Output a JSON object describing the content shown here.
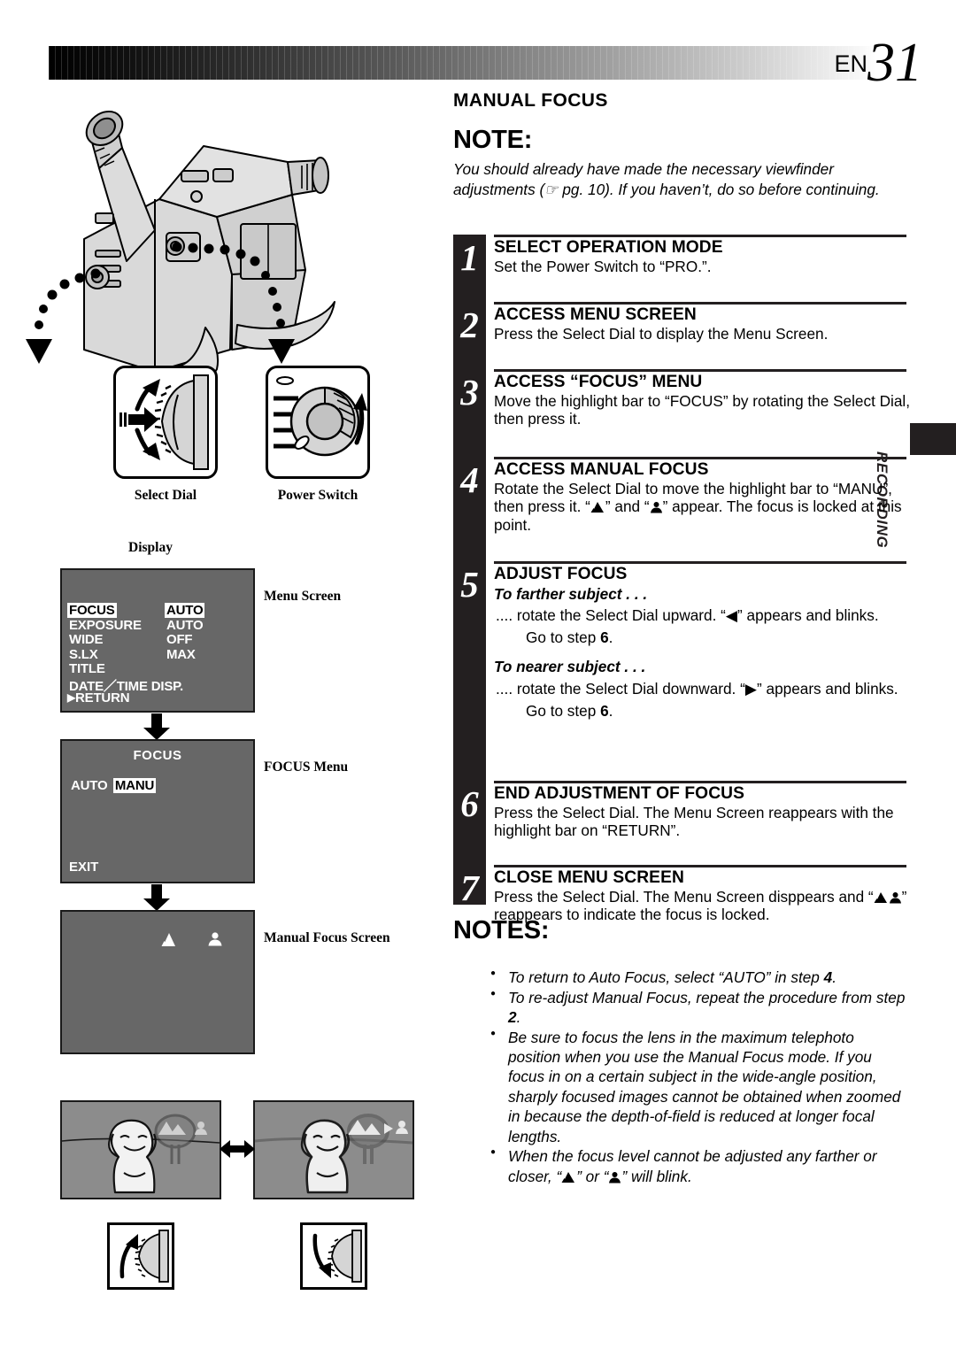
{
  "header": {
    "page_prefix": "EN",
    "page_number": "31"
  },
  "side_tab": {
    "label": "RECORDING"
  },
  "section": {
    "title": "MANUAL FOCUS",
    "note_heading": "NOTE:",
    "note_body": "You should already have made the necessary viewfinder adjustments (☞ pg. 10). If you haven’t, do so before continuing."
  },
  "steps": [
    {
      "num": "1",
      "title": "SELECT OPERATION MODE",
      "body": "Set the Power Switch to “PRO.”."
    },
    {
      "num": "2",
      "title": "ACCESS MENU SCREEN",
      "body": "Press the Select Dial to display the Menu Screen."
    },
    {
      "num": "3",
      "title": "ACCESS “FOCUS” MENU",
      "body": "Move the highlight bar to “FOCUS” by rotating the Select Dial, then press it."
    },
    {
      "num": "4",
      "title": "ACCESS MANUAL FOCUS",
      "body_a": "Rotate the Select Dial to move the highlight bar to “MANU”, then press it. “",
      "body_b": "” and “",
      "body_c": "” appear. The focus is locked at this point."
    },
    {
      "num": "5",
      "title": "ADJUST FOCUS",
      "sub_far": "To farther subject . . .",
      "far_a": ".... rotate the Select Dial upward. “◀” appears and blinks.",
      "far_goto_a": "Go to step ",
      "far_goto_b": "6",
      "far_goto_c": ".",
      "sub_near": "To nearer subject . . .",
      "near_a": ".... rotate the Select Dial downward. “▶” appears and blinks.",
      "near_goto_a": "Go to step ",
      "near_goto_b": "6",
      "near_goto_c": "."
    },
    {
      "num": "6",
      "title": "END ADJUSTMENT OF FOCUS",
      "body": "Press the Select Dial. The Menu Screen reappears with the highlight bar on “RETURN”."
    },
    {
      "num": "7",
      "title": "CLOSE MENU SCREEN",
      "body_a": "Press the Select Dial. The Menu Screen disppears and “",
      "body_b": "” reappears to indicate the focus is locked."
    }
  ],
  "notes": {
    "heading": "NOTES:",
    "items": [
      {
        "a": "To return to Auto Focus, select “AUTO” in step ",
        "b": "4",
        "c": "."
      },
      {
        "a": "To re-adjust Manual Focus, repeat the procedure from step ",
        "b": "2",
        "c": "."
      },
      {
        "a": "Be sure to focus the lens in the maximum telephoto position when you use the Manual Focus mode. If you focus in on a certain subject in the wide-angle position, sharply focused images cannot be obtained when zoomed in because the depth-of-field is reduced at longer focal lengths.",
        "b": "",
        "c": ""
      },
      {
        "a": "When the focus level cannot be adjusted any farther or closer, “",
        "b": "",
        "c": "” or “",
        "d": "” will blink."
      }
    ]
  },
  "controls": [
    {
      "caption": "Select Dial",
      "icon": "select-dial-icon"
    },
    {
      "caption": "Power Switch",
      "icon": "power-switch-icon"
    }
  ],
  "display": {
    "label": "Display",
    "menu_screen": {
      "caption": "Menu Screen",
      "rows": [
        {
          "label": "FOCUS",
          "value": "AUTO",
          "label_hl": true,
          "value_hl": true
        },
        {
          "label": "EXPOSURE",
          "value": "AUTO",
          "label_hl": false,
          "value_hl": false
        },
        {
          "label": "WIDE",
          "value": "OFF",
          "label_hl": false,
          "value_hl": false
        },
        {
          "label": "S.LX",
          "value": "MAX",
          "label_hl": false,
          "value_hl": false
        },
        {
          "label": "TITLE",
          "value": "",
          "label_hl": false,
          "value_hl": false
        },
        {
          "label": "DATE／TIME  DISP.",
          "value": "",
          "label_hl": false,
          "value_hl": false
        }
      ],
      "return_label": "RETURN"
    },
    "focus_menu": {
      "caption": "FOCUS Menu",
      "title": "FOCUS",
      "options": [
        {
          "label": "AUTO",
          "hl": false
        },
        {
          "label": "MANU",
          "hl": true
        }
      ],
      "exit_label": "EXIT"
    },
    "manual_focus_screen": {
      "caption": "Manual Focus Screen",
      "icons": [
        "mountain-icon",
        "person-icon"
      ]
    }
  },
  "colors": {
    "osd_background": "#676767",
    "osd_text": "#ffffff",
    "step_bar": "#231f20",
    "scene_background": "#8c8c8c",
    "ink": "#000000"
  }
}
